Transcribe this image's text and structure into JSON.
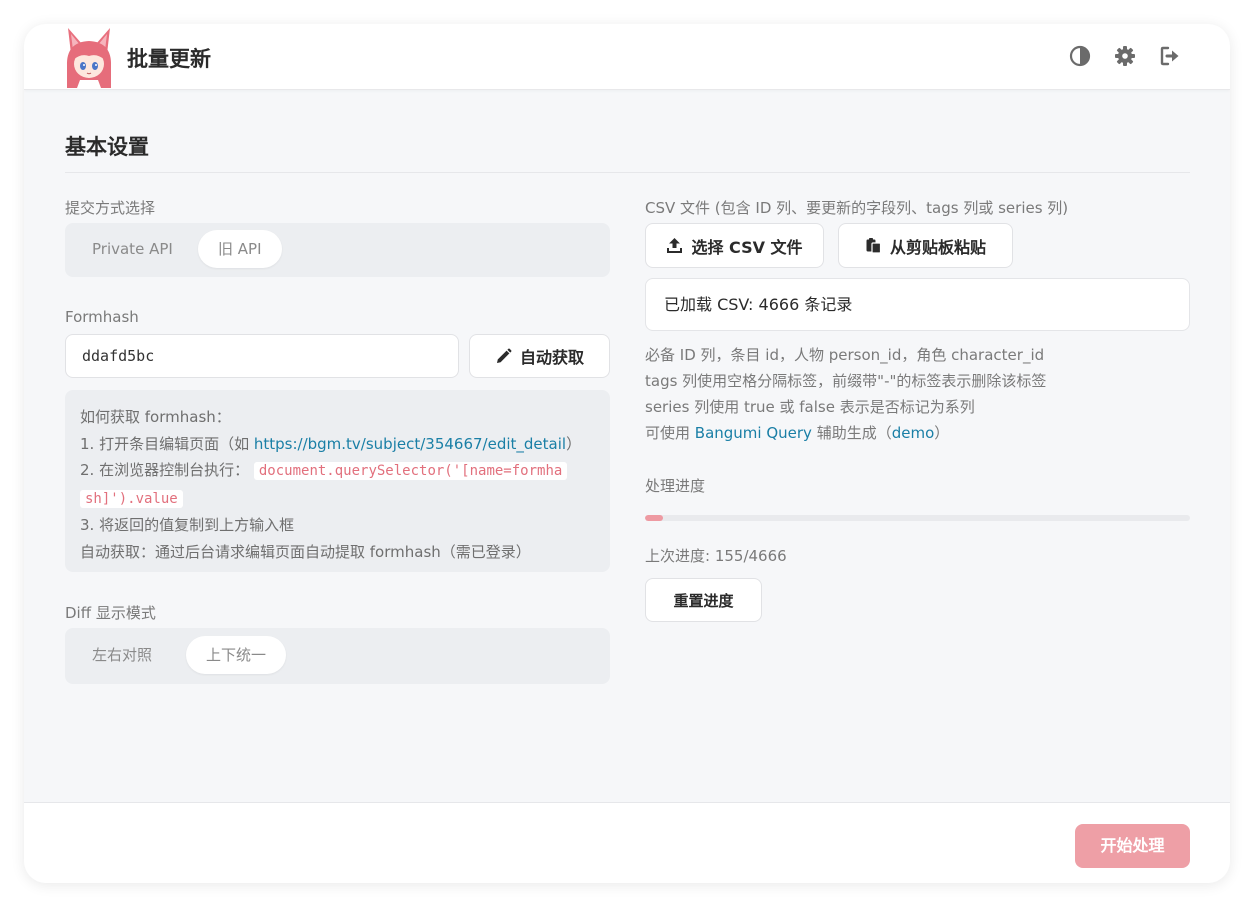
{
  "header": {
    "title": "批量更新",
    "icons": [
      "contrast-icon",
      "gear-icon",
      "logout-icon"
    ]
  },
  "settings": {
    "section_title": "基本设置",
    "submit_mode": {
      "label": "提交方式选择",
      "options": [
        "Private API",
        "旧 API"
      ],
      "selected": "旧 API"
    },
    "formhash": {
      "label": "Formhash",
      "value": "ddafd5bc",
      "auto_button": "自动获取"
    },
    "help": {
      "title": "如何获取 formhash：",
      "step1_prefix": "1. 打开条目编辑页面（如 ",
      "step1_link": "https://bgm.tv/subject/354667/edit_detail",
      "step1_suffix": "）",
      "step2_prefix": "2. 在浏览器控制台执行：",
      "step2_code_line1": "document.querySelector('[name=formha",
      "step2_code_line2": "sh]').value",
      "step3": "3. 将返回的值复制到上方输入框",
      "auto_note": "自动获取：通过后台请求编辑页面自动提取 formhash（需已登录）"
    },
    "diff_mode": {
      "label": "Diff 显示模式",
      "options": [
        "左右对照",
        "上下统一"
      ],
      "selected": "上下统一"
    }
  },
  "csv": {
    "label": "CSV 文件 (包含 ID 列、要更新的字段列、tags 列或 series 列)",
    "select_button": "选择 CSV 文件",
    "paste_button": "从剪贴板粘贴",
    "status": "已加载 CSV: 4666 条记录",
    "notes": {
      "line1": "必备 ID 列，条目 id，人物 person_id，角色 character_id",
      "line2": "tags 列使用空格分隔标签，前缀带\"-\"的标签表示删除该标签",
      "line3": "series 列使用 true 或 false 表示是否标记为系列",
      "line4_prefix": "可使用 ",
      "line4_link": "Bangumi Query",
      "line4_mid": " 辅助生成（",
      "line4_demo": "demo",
      "line4_suffix": "）"
    }
  },
  "progress": {
    "label": "处理进度",
    "done": 155,
    "total": 4666,
    "last_label": "上次进度: 155/4666",
    "reset_button": "重置进度"
  },
  "footer": {
    "start_button": "开始处理"
  },
  "colors": {
    "accent": "#ee9aa2",
    "link": "#1a7fa6",
    "code": "#e2707d"
  }
}
